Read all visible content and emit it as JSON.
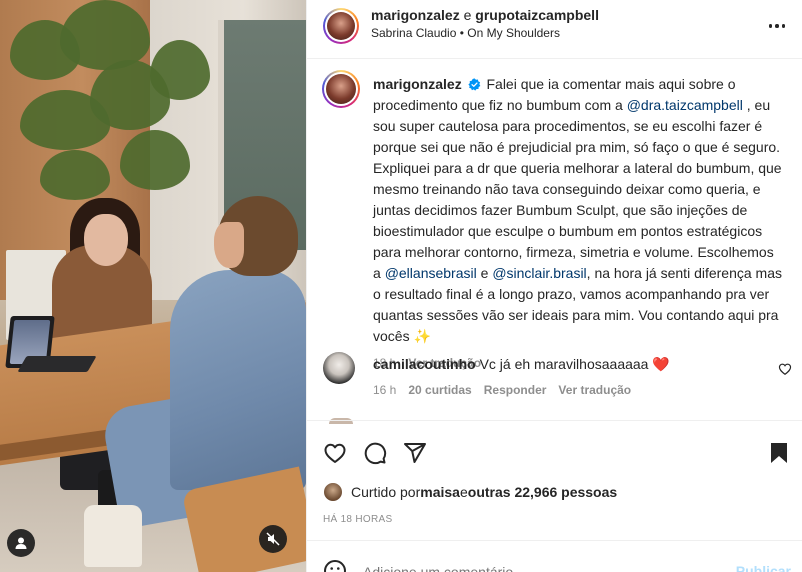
{
  "header": {
    "author": "marigonzalez",
    "connector": " e ",
    "collaborator": "grupotaizcampbell",
    "artist": "Sabrina Claudio",
    "separator": " • ",
    "song": "On My Shoulders"
  },
  "caption": {
    "username": "marigonzalez",
    "text_1": "Falei que ia comentar mais aqui sobre o procedimento que fiz no bumbum com a ",
    "mention_1": "@dra.taizcampbell",
    "text_2": " , eu sou super cautelosa para procedimentos, se eu escolhi fazer é porque sei que não é prejudicial pra mim, só faço o que é seguro. Expliquei para a dr que queria melhorar a lateral do bumbum, que mesmo treinando não tava conseguindo deixar como queria, e juntas decidimos fazer Bumbum Sculpt, que são injeções de bioestimulador que esculpe o bumbum em pontos estratégicos para melhorar contorno, firmeza, simetria e volume. Escolhemos a ",
    "mention_2": "@ellansebrasil",
    "text_3": " e ",
    "mention_3": "@sinclair.brasil",
    "text_4": ", na hora já senti diferença mas o resultado final é a longo prazo, vamos acompanhando pra ver quantas sessões vão ser ideais para mim. Vou contando aqui pra vocês ",
    "emoji": "✨",
    "time": "18 h",
    "translate": "Ver tradução"
  },
  "comment": {
    "username": "camilacoutinho",
    "text": "Vc já eh maravilhosaaaaaa ",
    "emoji": "❤️",
    "time": "16 h",
    "likes": "20 curtidas",
    "reply": "Responder",
    "translate": "Ver tradução"
  },
  "likes": {
    "prefix": "Curtido por ",
    "user": "maisa",
    "middle": " e ",
    "others": "outras 22,966 pessoas"
  },
  "timestamp": "HÁ 18 HORAS",
  "composer": {
    "placeholder": "Adicione um comentário...",
    "post_label": "Publicar"
  },
  "colors": {
    "verified": "#0095f6",
    "mention": "#00376b",
    "post_disabled": "#b2dffc",
    "heart": "#ed4956"
  },
  "icons": [
    "verified-icon",
    "more-options-icon",
    "heart-icon",
    "comment-icon",
    "share-icon",
    "bookmark-icon",
    "emoji-icon",
    "user-tag-icon",
    "mute-icon"
  ]
}
